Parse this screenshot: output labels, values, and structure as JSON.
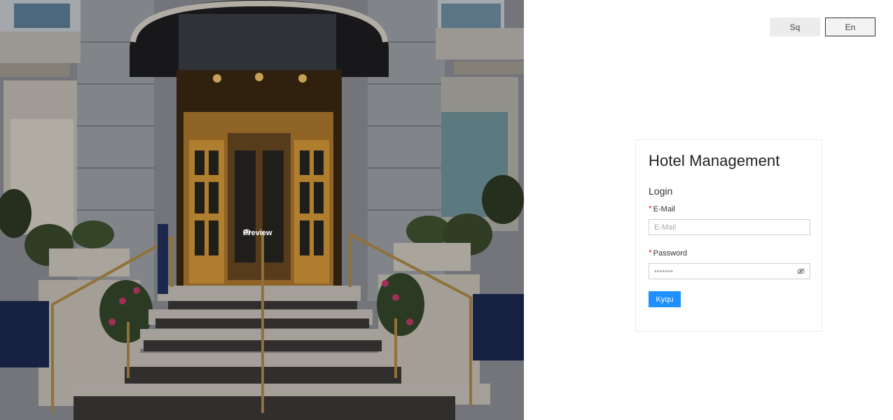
{
  "hero": {
    "preview_label": "Preview",
    "preview_icon": "eye-icon"
  },
  "language": {
    "options": [
      "Sq",
      "En"
    ],
    "selected": "En"
  },
  "login_card": {
    "app_title": "Hotel Management",
    "form_title": "Login",
    "email": {
      "label": "E-Mail",
      "required_mark": "*",
      "placeholder": "E-Mail",
      "value": ""
    },
    "password": {
      "label": "Password",
      "required_mark": "*",
      "value_masked": "•••••••",
      "toggle_icon": "eye-off-icon"
    },
    "submit_label": "Kyqu"
  },
  "colors": {
    "primary_button": "#1e90ff",
    "required_mark": "#e02828",
    "card_border": "#ececec"
  }
}
